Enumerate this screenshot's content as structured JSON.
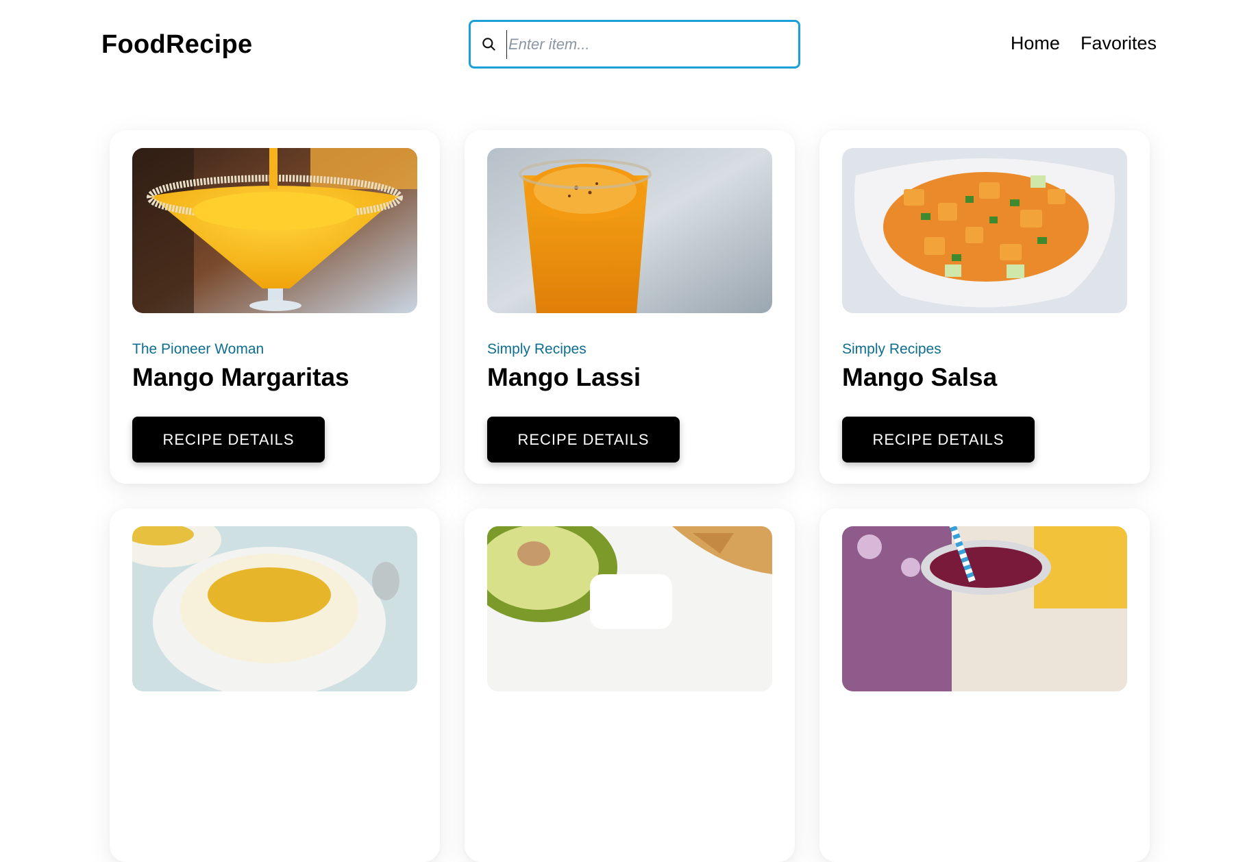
{
  "header": {
    "logo": "FoodRecipe",
    "search": {
      "placeholder": "Enter item...",
      "value": ""
    },
    "nav": [
      {
        "label": "Home"
      },
      {
        "label": "Favorites"
      }
    ]
  },
  "cards": [
    {
      "publisher": "The Pioneer Woman",
      "title": "Mango Margaritas",
      "button": "RECIPE DETAILS",
      "image": "mango-margarita-image"
    },
    {
      "publisher": "Simply Recipes",
      "title": "Mango Lassi",
      "button": "RECIPE DETAILS",
      "image": "mango-lassi-image"
    },
    {
      "publisher": "Simply Recipes",
      "title": "Mango Salsa",
      "button": "RECIPE DETAILS",
      "image": "mango-salsa-image"
    },
    {
      "publisher": "",
      "title": "",
      "button": "",
      "image": "mango-pudding-image"
    },
    {
      "publisher": "",
      "title": "",
      "button": "",
      "image": "avocado-mango-salsa-image"
    },
    {
      "publisher": "",
      "title": "",
      "button": "",
      "image": "berry-smoothie-image"
    }
  ],
  "colors": {
    "search_border": "#1a9fd8",
    "publisher_text": "#0e6e8f",
    "button_bg": "#000000"
  }
}
